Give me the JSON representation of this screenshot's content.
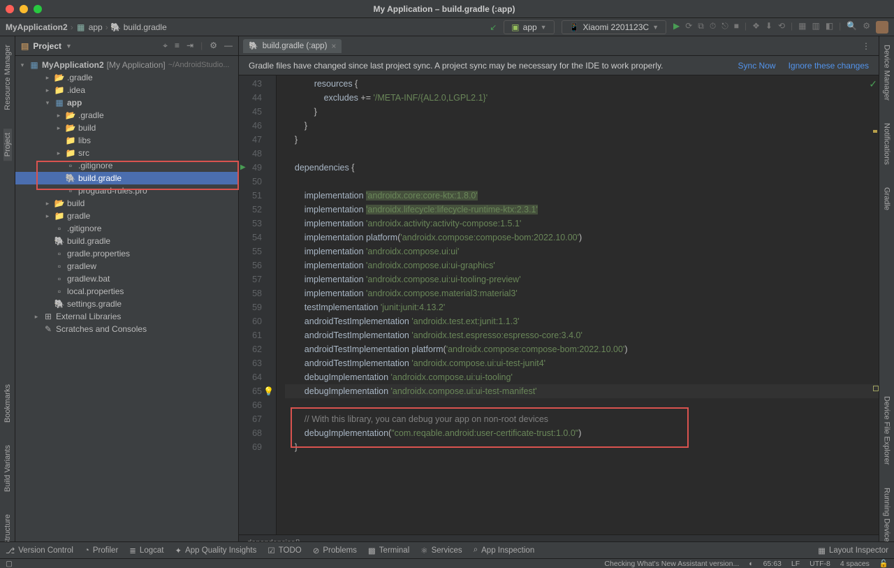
{
  "window": {
    "title": "My Application – build.gradle (:app)"
  },
  "breadcrumb": {
    "root": "MyApplication2",
    "sep": "›",
    "mod": "app",
    "file": "build.gradle"
  },
  "run_config": {
    "label": "app"
  },
  "device": {
    "label": "Xiaomi 2201123C"
  },
  "project_panel": {
    "header": "Project",
    "tree": {
      "root": "MyApplication2",
      "root_bracket": "[My Application]",
      "root_path": "~/AndroidStudio...",
      "items": [
        {
          "d": 1,
          "exp": "▸",
          "icon": "folder-open",
          "cls": "folder-open",
          "label": ".gradle"
        },
        {
          "d": 1,
          "exp": "▸",
          "icon": "folder",
          "cls": "folder",
          "label": ".idea"
        },
        {
          "d": 1,
          "exp": "▾",
          "icon": "module",
          "cls": "module",
          "label": "app",
          "bold": true
        },
        {
          "d": 2,
          "exp": "▸",
          "icon": "folder-open",
          "cls": "folder-open",
          "label": ".gradle"
        },
        {
          "d": 2,
          "exp": "▸",
          "icon": "folder-open",
          "cls": "folder-open",
          "label": "build"
        },
        {
          "d": 2,
          "exp": "",
          "icon": "folder",
          "cls": "folder",
          "label": "libs"
        },
        {
          "d": 2,
          "exp": "▸",
          "icon": "folder",
          "cls": "folder",
          "label": "src"
        },
        {
          "d": 2,
          "exp": "",
          "icon": "file",
          "cls": "file-plain",
          "label": ".gitignore"
        },
        {
          "d": 2,
          "exp": "",
          "icon": "gradle",
          "cls": "file-g",
          "label": "build.gradle",
          "sel": true
        },
        {
          "d": 2,
          "exp": "",
          "icon": "file",
          "cls": "file-plain",
          "label": "proguard-rules.pro"
        },
        {
          "d": 1,
          "exp": "▸",
          "icon": "folder-open",
          "cls": "folder-open",
          "label": "build"
        },
        {
          "d": 1,
          "exp": "▸",
          "icon": "folder",
          "cls": "folder",
          "label": "gradle"
        },
        {
          "d": 1,
          "exp": "",
          "icon": "file",
          "cls": "file-plain",
          "label": ".gitignore"
        },
        {
          "d": 1,
          "exp": "",
          "icon": "gradle",
          "cls": "file-g",
          "label": "build.gradle"
        },
        {
          "d": 1,
          "exp": "",
          "icon": "file",
          "cls": "file-plain",
          "label": "gradle.properties"
        },
        {
          "d": 1,
          "exp": "",
          "icon": "file",
          "cls": "file-plain",
          "label": "gradlew"
        },
        {
          "d": 1,
          "exp": "",
          "icon": "file",
          "cls": "file-plain",
          "label": "gradlew.bat"
        },
        {
          "d": 1,
          "exp": "",
          "icon": "file",
          "cls": "file-plain",
          "label": "local.properties"
        },
        {
          "d": 1,
          "exp": "",
          "icon": "gradle",
          "cls": "file-g",
          "label": "settings.gradle"
        },
        {
          "d": 0,
          "exp": "▸",
          "icon": "lib",
          "cls": "file-plain",
          "label": "External Libraries"
        },
        {
          "d": 0,
          "exp": "",
          "icon": "scratch",
          "cls": "file-plain",
          "label": "Scratches and Consoles"
        }
      ]
    }
  },
  "left_tools": [
    "Resource Manager",
    "Project",
    "Bookmarks",
    "Build Variants",
    "Structure"
  ],
  "right_tools": [
    "Device Manager",
    "Notifications",
    "Gradle",
    "Device File Explorer",
    "Running Devices"
  ],
  "editor": {
    "tab_label": "build.gradle (:app)",
    "gradle_banner_msg": "Gradle files have changed since last project sync. A project sync may be necessary for the IDE to work properly.",
    "sync_now": "Sync Now",
    "ignore": "Ignore these changes",
    "first_line": 43,
    "lines": [
      "            resources {",
      "                excludes += '/META-INF/{AL2.0,LGPL2.1}'",
      "            }",
      "        }",
      "    }",
      "",
      "    dependencies {",
      "",
      "        implementation |H|'androidx.core:core-ktx:1.8.0'",
      "        implementation |H|'androidx.lifecycle:lifecycle-runtime-ktx:2.3.1'",
      "        implementation 'androidx.activity:activity-compose:1.5.1'",
      "        implementation platform('androidx.compose:compose-bom:2022.10.00')",
      "        implementation 'androidx.compose.ui:ui'",
      "        implementation 'androidx.compose.ui:ui-graphics'",
      "        implementation 'androidx.compose.ui:ui-tooling-preview'",
      "        implementation 'androidx.compose.material3:material3'",
      "        testImplementation 'junit:junit:4.13.2'",
      "        androidTestImplementation 'androidx.test.ext:junit:1.1.3'",
      "        androidTestImplementation 'androidx.test.espresso:espresso-core:3.4.0'",
      "        androidTestImplementation platform('androidx.compose:compose-bom:2022.10.00')",
      "        androidTestImplementation 'androidx.compose.ui:ui-test-junit4'",
      "        debugImplementation 'androidx.compose.ui:ui-tooling'",
      "        debugImplementation 'androidx.compose.ui:ui-test-manifest'",
      "",
      "        |C|// With this library, you can debug your app on non-root devices",
      "        debugImplementation(|S|\"com.reqable.android:user-certificate-trust:1.0.0\"|/S|)",
      "    }"
    ],
    "breadcrumb_bottom": "dependencies{}"
  },
  "bottom_items": [
    "Version Control",
    "Profiler",
    "Logcat",
    "App Quality Insights",
    "TODO",
    "Problems",
    "Terminal",
    "Services",
    "App Inspection"
  ],
  "bottom_right": "Layout Inspector",
  "status": {
    "msg": "Checking What's New Assistant version...",
    "cursor": "65:63",
    "sep": "LF",
    "enc": "UTF-8",
    "indent": "4 spaces"
  }
}
